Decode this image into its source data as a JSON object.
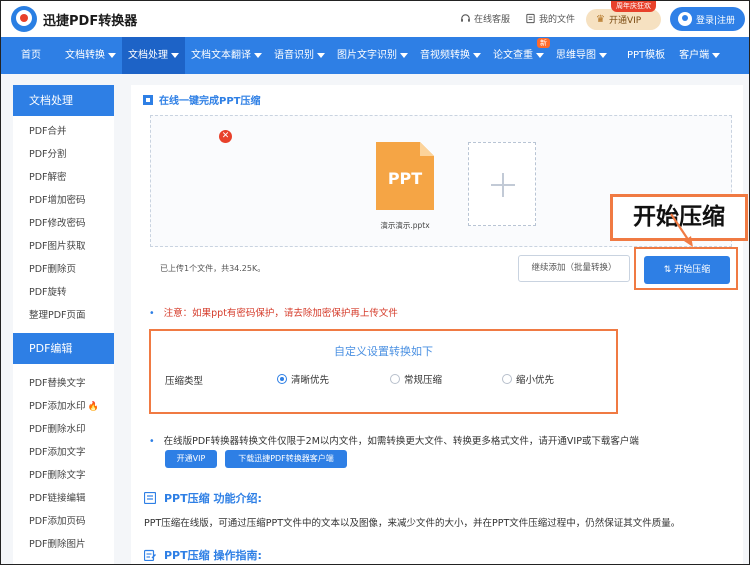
{
  "header": {
    "app_title": "迅捷PDF转换器",
    "service_label": "在线客服",
    "files_label": "我的文件",
    "vip_label": "开通VIP",
    "vip_tag": "周年庆狂欢",
    "login_label": "登录|注册"
  },
  "nav": {
    "items": [
      {
        "label": "首页",
        "dropdown": false
      },
      {
        "label": "文档转换",
        "dropdown": true
      },
      {
        "label": "文档处理",
        "dropdown": true,
        "active": true
      },
      {
        "label": "文档文本翻译",
        "dropdown": true
      },
      {
        "label": "语音识别",
        "dropdown": true
      },
      {
        "label": "图片文字识别",
        "dropdown": true
      },
      {
        "label": "音视频转换",
        "dropdown": true
      },
      {
        "label": "论文查重",
        "dropdown": true,
        "badge": "新"
      },
      {
        "label": "思维导图",
        "dropdown": true
      },
      {
        "label": "PPT模板",
        "dropdown": false
      },
      {
        "label": "客户端",
        "dropdown": true
      }
    ]
  },
  "sidebar": {
    "section1_title": "文档处理",
    "section1_items": [
      "PDF合并",
      "PDF分割",
      "PDF解密",
      "PDF增加密码",
      "PDF修改密码",
      "PDF图片获取",
      "PDF删除页",
      "PDF旋转",
      "整理PDF页面"
    ],
    "section2_title": "PDF编辑",
    "section2_items": [
      "PDF替换文字",
      "PDF添加水印",
      "PDF删除水印",
      "PDF添加文字",
      "PDF删除文字",
      "PDF链接编辑",
      "PDF添加页码",
      "PDF删除图片"
    ]
  },
  "main": {
    "section_title": "在线一键完成PPT压缩",
    "file_icon_label": "PPT",
    "file_name": "演示演示.pptx",
    "callout_text": "开始压缩",
    "status_text": "已上传1个文件，共34.25K。",
    "batch_button": "继续添加（批量转换）",
    "start_button": "开始压缩",
    "note": "注意：如果ppt有密码保护，请去除加密保护再上传文件",
    "settings_title": "自定义设置转换如下",
    "settings_label": "压缩类型",
    "options": [
      {
        "label": "清晰优先",
        "checked": true
      },
      {
        "label": "常规压缩",
        "checked": false
      },
      {
        "label": "缩小优先",
        "checked": false
      }
    ],
    "info_text": "在线版PDF转换器转换文件仅限于2M以内文件，如需转换更大文件、转换更多格式文件，请开通VIP或下载客户端",
    "info_vip_button": "开通VIP",
    "info_download_button": "下载迅捷PDF转换器客户端",
    "intro_title": "PPT压缩 功能介绍:",
    "intro_text": "PPT压缩在线版，可通过压缩PPT文件中的文本以及图像，来减少文件的大小，并在PPT文件压缩过程中，仍然保证其文件质量。",
    "guide_title": "PPT压缩 操作指南:"
  },
  "colors": {
    "brand": "#2e7fe5",
    "highlight": "#f07a43",
    "warning": "#d53b2a",
    "ppt_orange": "#f39a3c"
  }
}
